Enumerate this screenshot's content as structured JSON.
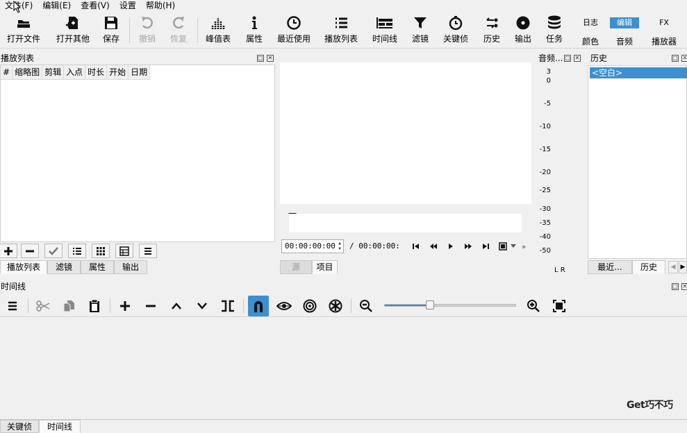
{
  "menu": [
    "文件(F)",
    "编辑(E)",
    "查看(V)",
    "设置",
    "帮助(H)"
  ],
  "toolbar": {
    "open_file": "打开文件",
    "open_other": "打开其他",
    "save": "保存",
    "undo": "撤销",
    "redo": "恢复",
    "peak_meter": "峰值表",
    "properties": "属性",
    "recent": "最近使用",
    "playlist": "播放列表",
    "timeline": "时间线",
    "filters": "滤镜",
    "keyframes": "关键侦",
    "history": "历史",
    "export": "输出",
    "jobs": "任务",
    "layout_tabs_top": [
      "日志",
      "编辑",
      "FX"
    ],
    "layout_tabs_bottom": [
      "颜色",
      "音频",
      "播放器"
    ]
  },
  "playlist": {
    "title": "播放列表",
    "columns": [
      "#",
      "缩略图",
      "剪辑",
      "入点",
      "时长",
      "开始",
      "日期"
    ],
    "tabs": [
      "播放列表",
      "滤镜",
      "属性",
      "输出"
    ]
  },
  "player": {
    "timecode": "00:00:00:00",
    "total": "/ 00:00:00:",
    "source_tab": "源",
    "project_tab": "项目"
  },
  "audio_meter": {
    "title": "音频...",
    "scale": [
      "3",
      "0",
      "-5",
      "-10",
      "-15",
      "-20",
      "-25",
      "-30",
      "-35",
      "-40",
      "-50"
    ],
    "channels": "L R"
  },
  "history": {
    "title": "历史",
    "items": [
      "<空白>"
    ],
    "tabs": [
      "最近...",
      "历史"
    ]
  },
  "timeline": {
    "title": "时间线",
    "zoom_level": 0.35
  },
  "watermark": "Get巧不巧",
  "bottom_tabs": [
    "关键侦",
    "时间线"
  ],
  "colors": {
    "accent": "#3d8fd0"
  }
}
